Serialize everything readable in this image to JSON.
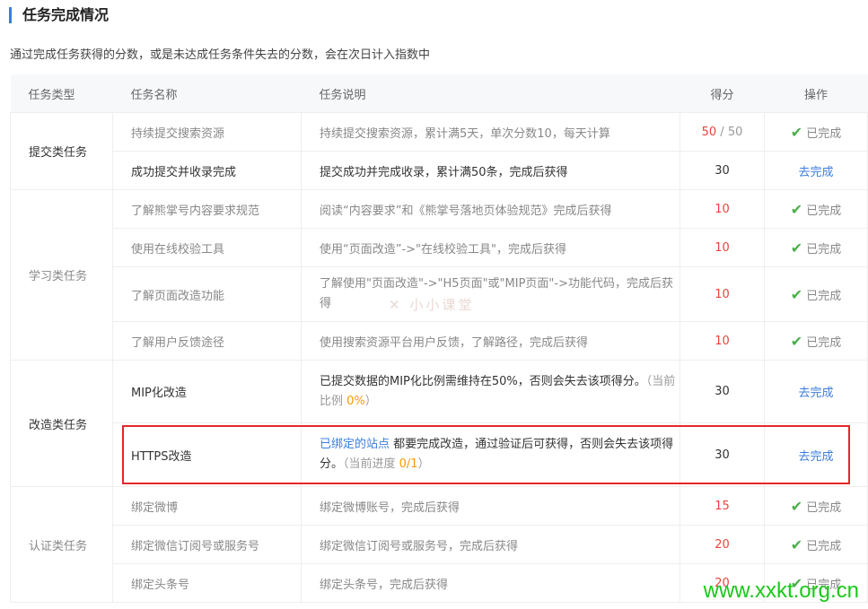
{
  "header": {
    "title": "任务完成情况"
  },
  "description": "通过完成任务获得的分数，或是未达成任务条件失去的分数，会在次日计入指数中",
  "table": {
    "columns": [
      "任务类型",
      "任务名称",
      "任务说明",
      "得分",
      "操作"
    ],
    "groups": [
      {
        "category": "提交类任务",
        "rows": [
          {
            "name": "持续提交搜索资源",
            "desc": "持续提交搜索资源，累计满5天，单次分数10，每天计算",
            "score_a": "50",
            "score_sep": " / ",
            "score_b": "50",
            "op": "已完成"
          },
          {
            "name": "成功提交并收录完成",
            "desc": "提交成功并完成收录，累计满50条，完成后获得",
            "score": "30",
            "op": "去完成"
          }
        ]
      },
      {
        "category": "学习类任务",
        "rows": [
          {
            "name": "了解熊掌号内容要求规范",
            "desc": "阅读“内容要求”和《熊掌号落地页体验规范》完成后获得",
            "score": "10",
            "op": "已完成"
          },
          {
            "name": "使用在线校验工具",
            "desc": "使用“页面改造”->\"在线校验工具\"，完成后获得",
            "score": "10",
            "op": "已完成"
          },
          {
            "name": "了解页面改造功能",
            "desc": "了解使用\"页面改造\"->\"H5页面\"或\"MIP页面\"->功能代码，完成后获得",
            "score": "10",
            "op": "已完成"
          },
          {
            "name": "了解用户反馈途径",
            "desc": "使用搜索资源平台用户反馈，了解路径，完成后获得",
            "score": "10",
            "op": "已完成"
          }
        ]
      },
      {
        "category": "改造类任务",
        "rows": [
          {
            "name": "MIP化改造",
            "desc": "已提交数据的MIP化比例需维持在50%，否则会失去该项得分。",
            "progress_label": "（当前比例 ",
            "progress_value": "0%",
            "progress_end": "）",
            "score": "30",
            "op": "去完成"
          },
          {
            "name": "HTTPS改造",
            "desc_link": "已绑定的站点",
            "desc": " 都要完成改造，通过验证后可获得，否则会失去该项得分。",
            "progress_label": "（当前进度 ",
            "progress_value": "0/1",
            "progress_end": "）",
            "score": "30",
            "op": "去完成"
          }
        ]
      },
      {
        "category": "认证类任务",
        "rows": [
          {
            "name": "绑定微博",
            "desc": "绑定微博账号，完成后获得",
            "score": "15",
            "op": "已完成"
          },
          {
            "name": "绑定微信订阅号或服务号",
            "desc": "绑定微信订阅号或服务号，完成后获得",
            "score": "20",
            "op": "已完成"
          },
          {
            "name": "绑定头条号",
            "desc": "绑定头条号，完成后获得",
            "score": "20",
            "op": "已完成"
          }
        ]
      }
    ]
  },
  "watermark": "小小课堂",
  "site_watermark": "www.xxkt.org.cn",
  "colors": {
    "accent": "#3b7ddd",
    "score_red": "#e8443a",
    "progress_orange": "#ff9900",
    "check_green": "#4cae4c",
    "highlight_red": "#e5262b"
  }
}
